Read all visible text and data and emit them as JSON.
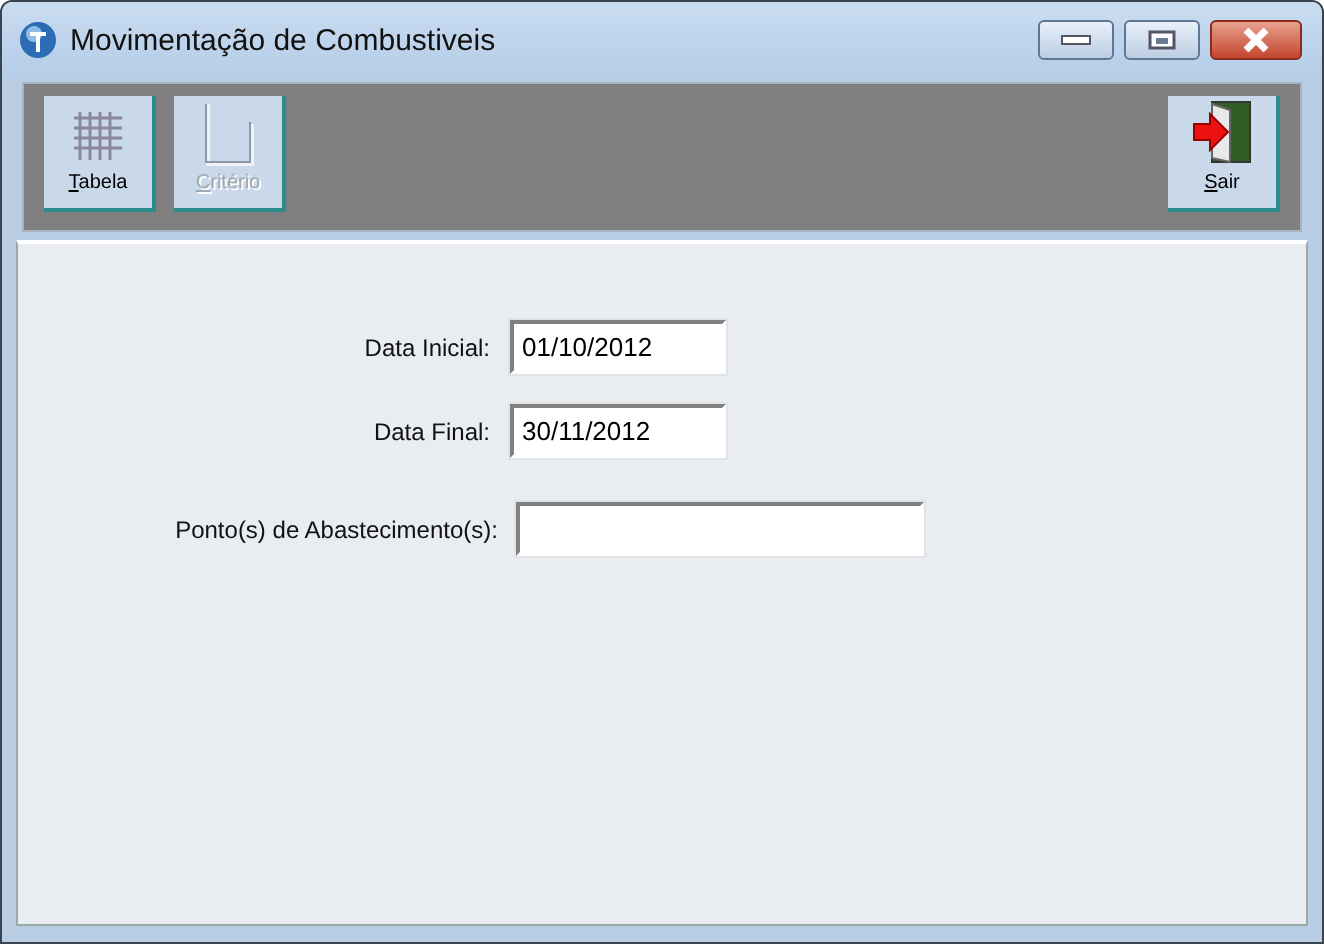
{
  "window": {
    "title": "Movimentação de Combustiveis"
  },
  "toolbar": {
    "buttons": [
      {
        "label": "Tabela",
        "kind": "grid",
        "disabled": false
      },
      {
        "label": "Critério",
        "kind": "criteria",
        "disabled": true
      },
      {
        "label": "Sair",
        "kind": "exit",
        "disabled": false
      }
    ]
  },
  "form": {
    "fields": [
      {
        "label": "Data Inicial:",
        "value": "01/10/2012",
        "kind": "short"
      },
      {
        "label": "Data Final:",
        "value": "30/11/2012",
        "kind": "short"
      },
      {
        "label": "Ponto(s) de Abastecimento(s):",
        "kind": "long"
      }
    ]
  }
}
